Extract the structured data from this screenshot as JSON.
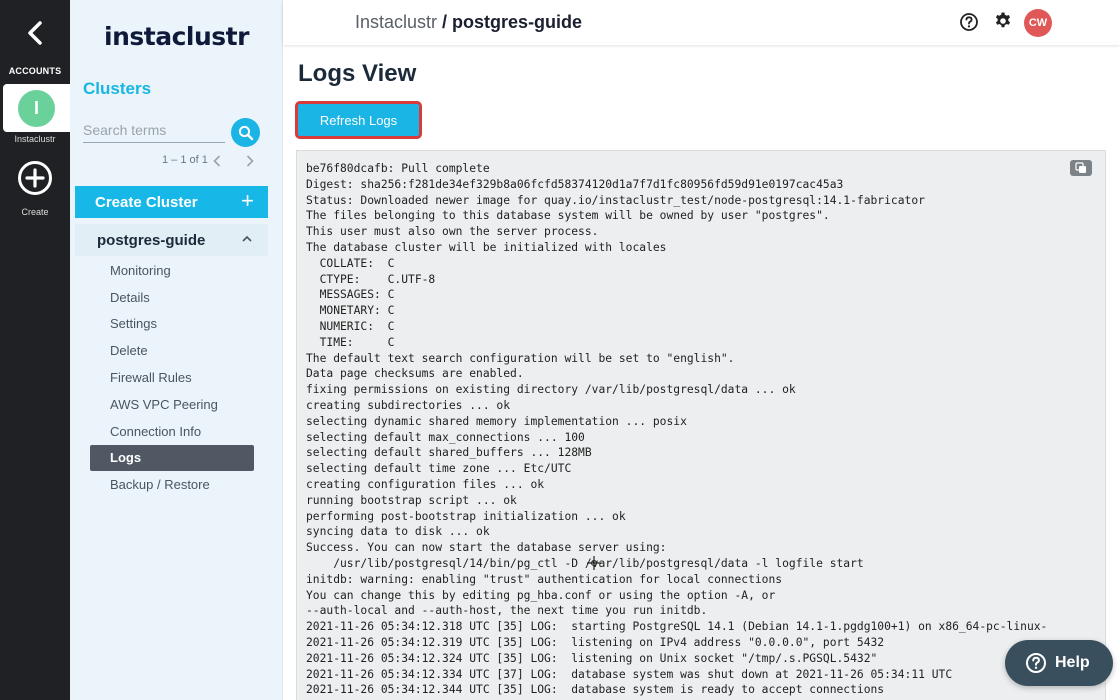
{
  "rail": {
    "accounts_label": "ACCOUNTS",
    "account_initial": "I",
    "account_name": "Instaclustr",
    "create_label": "Create"
  },
  "sidebar": {
    "logo": "instaclustr",
    "clusters_title": "Clusters",
    "search_placeholder": "Search terms",
    "pager": "1 – 1 of 1",
    "create_cluster_label": "Create Cluster",
    "cluster_name": "postgres-guide",
    "nav_items": [
      "Monitoring",
      "Details",
      "Settings",
      "Delete",
      "Firewall Rules",
      "AWS VPC Peering",
      "Connection Info",
      "Logs",
      "Backup / Restore"
    ],
    "active_index": 7
  },
  "header": {
    "org": "Instaclustr",
    "separator": " / ",
    "cluster": "postgres-guide",
    "user_initials": "CW"
  },
  "main": {
    "title": "Logs View",
    "refresh_label": "Refresh Logs",
    "log_lines": [
      "be76f80dcafb: Pull complete",
      "Digest: sha256:f281de34ef329b8a06fcfd58374120d1a7f7d1fc80956fd59d91e0197cac45a3",
      "Status: Downloaded newer image for quay.io/instaclustr_test/node-postgresql:14.1-fabricator",
      "The files belonging to this database system will be owned by user \"postgres\".",
      "This user must also own the server process.",
      "The database cluster will be initialized with locales",
      "  COLLATE:  C",
      "  CTYPE:    C.UTF-8",
      "  MESSAGES: C",
      "  MONETARY: C",
      "  NUMERIC:  C",
      "  TIME:     C",
      "The default text search configuration will be set to \"english\".",
      "Data page checksums are enabled.",
      "fixing permissions on existing directory /var/lib/postgresql/data ... ok",
      "creating subdirectories ... ok",
      "selecting dynamic shared memory implementation ... posix",
      "selecting default max_connections ... 100",
      "selecting default shared_buffers ... 128MB",
      "selecting default time zone ... Etc/UTC",
      "creating configuration files ... ok",
      "running bootstrap script ... ok",
      "performing post-bootstrap initialization ... ok",
      "syncing data to disk ... ok",
      "Success. You can now start the database server using:",
      "    /usr/lib/postgresql/14/bin/pg_ctl -D /var/lib/postgresql/data -l logfile start",
      "initdb: warning: enabling \"trust\" authentication for local connections",
      "You can change this by editing pg_hba.conf or using the option -A, or",
      "--auth-local and --auth-host, the next time you run initdb.",
      "2021-11-26 05:34:12.318 UTC [35] LOG:  starting PostgreSQL 14.1 (Debian 14.1-1.pgdg100+1) on x86_64-pc-linux-",
      "2021-11-26 05:34:12.319 UTC [35] LOG:  listening on IPv4 address \"0.0.0.0\", port 5432",
      "2021-11-26 05:34:12.324 UTC [35] LOG:  listening on Unix socket \"/tmp/.s.PGSQL.5432\"",
      "2021-11-26 05:34:12.334 UTC [37] LOG:  database system was shut down at 2021-11-26 05:34:11 UTC",
      "2021-11-26 05:34:12.344 UTC [35] LOG:  database system is ready to accept connections"
    ]
  },
  "help_button": "Help",
  "colors": {
    "accent": "#17b7e8",
    "rail": "#202124",
    "sidebar": "#eaf4fa",
    "active_nav": "#505863",
    "avatar_account": "#6bd19a",
    "avatar_user": "#e05757",
    "highlight_border": "#d93a3a",
    "help_button": "#3a4f5e"
  },
  "icons": {
    "back": "chevron-left-icon",
    "create": "plus-circle-icon",
    "search": "search-icon",
    "pager_prev": "chevron-left-icon",
    "pager_next": "chevron-right-icon",
    "cluster_toggle": "chevron-up-icon",
    "help": "question-circle-icon",
    "settings": "gear-icon",
    "copy": "copy-icon",
    "cursor": "crosshair-cursor-icon"
  }
}
